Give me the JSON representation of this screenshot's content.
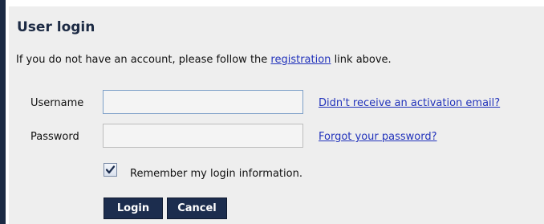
{
  "login": {
    "title": "User login",
    "intro_before": "If you do not have an account, please follow the ",
    "intro_link": "registration",
    "intro_after": " link above.",
    "username_label": "Username",
    "username_value": "",
    "password_label": "Password",
    "password_value": "",
    "activation_link": "Didn't receive an activation email?",
    "forgot_link": "Forgot your password?",
    "remember_label": "Remember my login information.",
    "remember_checked": true,
    "login_button": "Login",
    "cancel_button": "Cancel"
  },
  "colors": {
    "accent_navy": "#1c2d4e",
    "link_blue": "#2233bb",
    "panel_bg": "#eeeeee"
  }
}
